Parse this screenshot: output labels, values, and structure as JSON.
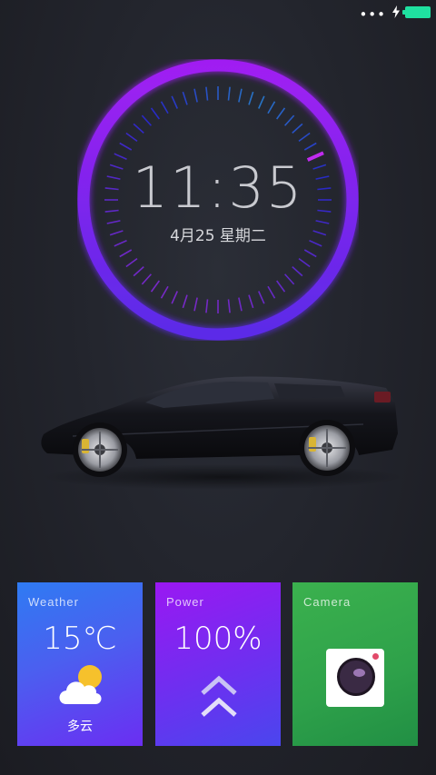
{
  "status_bar": {
    "signal_dots": "•••",
    "battery_color": "#1fe0a0"
  },
  "clock": {
    "time": "11:35",
    "date": "4月25 星期二",
    "ring_gradient": [
      "#a01ff2",
      "#5b2be8"
    ],
    "second_marker_color": "#c02bf0"
  },
  "tiles": {
    "weather": {
      "label": "Weather",
      "value": "15℃",
      "description": "多云",
      "icon": "partly-cloudy-icon"
    },
    "power": {
      "label": "Power",
      "value": "100%",
      "icon": "double-chevron-up-icon"
    },
    "camera": {
      "label": "Camera",
      "icon": "camera-icon"
    }
  }
}
